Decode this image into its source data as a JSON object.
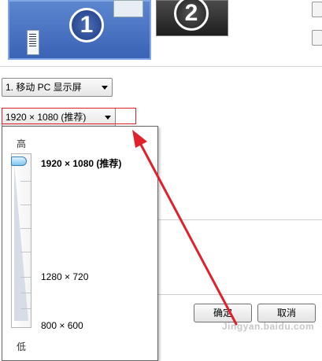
{
  "monitors": [
    {
      "number": "1",
      "selected": true
    },
    {
      "number": "2",
      "selected": false
    }
  ],
  "display_select": {
    "value": "1. 移动 PC 显示屏"
  },
  "resolution_select": {
    "value": "1920 × 1080 (推荐)"
  },
  "resolution_slider": {
    "high_label": "高",
    "low_label": "低",
    "options": [
      "1920 × 1080 (推荐)",
      "1280 × 720",
      "800 × 600"
    ],
    "selected": "1920 × 1080 (推荐)",
    "level_fraction": 1.0
  },
  "buttons": {
    "ok": "确定",
    "cancel": "取消"
  },
  "watermark": {
    "text": "Jingyan.baidu.com"
  },
  "colors": {
    "annotation": "#e0202b",
    "monitor_blue": "#3a63b6",
    "thumb": "#7fc6ef"
  }
}
